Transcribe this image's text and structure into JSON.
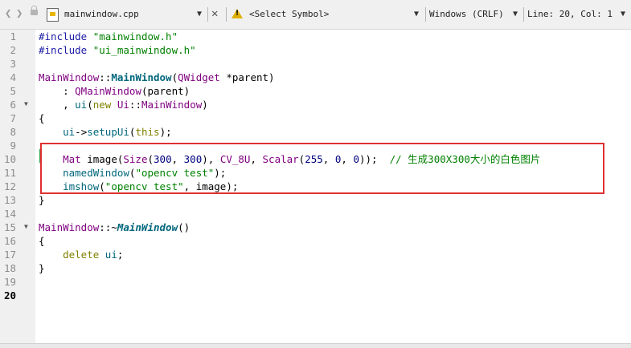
{
  "toolbar": {
    "back": "❮",
    "forward": "❯",
    "filename": "mainwindow.cpp",
    "dropdown": "▼",
    "close": "✕",
    "symbol": "<Select Symbol>",
    "encoding": "Windows (CRLF)",
    "position": "Line: 20, Col: 1",
    "warn_mark": "!"
  },
  "lines": [
    {
      "n": "1",
      "segs": [
        {
          "t": "#include ",
          "c": "c-pre"
        },
        {
          "t": "\"mainwindow.h\"",
          "c": "c-str"
        }
      ]
    },
    {
      "n": "2",
      "segs": [
        {
          "t": "#include ",
          "c": "c-pre"
        },
        {
          "t": "\"ui_mainwindow.h\"",
          "c": "c-str"
        }
      ]
    },
    {
      "n": "3",
      "segs": []
    },
    {
      "n": "4",
      "segs": [
        {
          "t": "MainWindow",
          "c": "c-cls"
        },
        {
          "t": "::",
          "c": ""
        },
        {
          "t": "MainWindow",
          "c": "c-bold"
        },
        {
          "t": "(",
          "c": ""
        },
        {
          "t": "QWidget",
          "c": "c-cls"
        },
        {
          "t": " *parent)",
          "c": ""
        }
      ]
    },
    {
      "n": "5",
      "segs": [
        {
          "t": "    : ",
          "c": ""
        },
        {
          "t": "QMainWindow",
          "c": "c-cls"
        },
        {
          "t": "(parent)",
          "c": ""
        }
      ]
    },
    {
      "n": "6",
      "segs": [
        {
          "t": "    , ",
          "c": ""
        },
        {
          "t": "ui",
          "c": "c-fn"
        },
        {
          "t": "(",
          "c": ""
        },
        {
          "t": "new",
          "c": "c-kw"
        },
        {
          "t": " ",
          "c": ""
        },
        {
          "t": "Ui",
          "c": "c-cls"
        },
        {
          "t": "::",
          "c": ""
        },
        {
          "t": "MainWindow",
          "c": "c-cls"
        },
        {
          "t": ")",
          "c": ""
        }
      ]
    },
    {
      "n": "7",
      "segs": [
        {
          "t": "{",
          "c": ""
        }
      ]
    },
    {
      "n": "8",
      "segs": [
        {
          "t": "    ",
          "c": ""
        },
        {
          "t": "ui",
          "c": "c-fn"
        },
        {
          "t": "->",
          "c": ""
        },
        {
          "t": "setupUi",
          "c": "c-fn"
        },
        {
          "t": "(",
          "c": ""
        },
        {
          "t": "this",
          "c": "c-kw"
        },
        {
          "t": ");",
          "c": ""
        }
      ]
    },
    {
      "n": "9",
      "segs": []
    },
    {
      "n": "10",
      "segs": [
        {
          "t": "    ",
          "c": ""
        },
        {
          "t": "Mat",
          "c": "c-cls"
        },
        {
          "t": " image(",
          "c": ""
        },
        {
          "t": "Size",
          "c": "c-cls"
        },
        {
          "t": "(",
          "c": ""
        },
        {
          "t": "300",
          "c": "c-num"
        },
        {
          "t": ", ",
          "c": ""
        },
        {
          "t": "300",
          "c": "c-num"
        },
        {
          "t": "), ",
          "c": ""
        },
        {
          "t": "CV_8U",
          "c": "c-cls"
        },
        {
          "t": ", ",
          "c": ""
        },
        {
          "t": "Scalar",
          "c": "c-cls"
        },
        {
          "t": "(",
          "c": ""
        },
        {
          "t": "255",
          "c": "c-num"
        },
        {
          "t": ", ",
          "c": ""
        },
        {
          "t": "0",
          "c": "c-num"
        },
        {
          "t": ", ",
          "c": ""
        },
        {
          "t": "0",
          "c": "c-num"
        },
        {
          "t": "));  ",
          "c": ""
        },
        {
          "t": "// 生成300X300大小的白色图片",
          "c": "c-cmt"
        }
      ]
    },
    {
      "n": "11",
      "segs": [
        {
          "t": "    ",
          "c": ""
        },
        {
          "t": "namedWindow",
          "c": "c-fn"
        },
        {
          "t": "(",
          "c": ""
        },
        {
          "t": "\"opencv test\"",
          "c": "c-str"
        },
        {
          "t": ");",
          "c": ""
        }
      ]
    },
    {
      "n": "12",
      "segs": [
        {
          "t": "    ",
          "c": ""
        },
        {
          "t": "imshow",
          "c": "c-fn"
        },
        {
          "t": "(",
          "c": ""
        },
        {
          "t": "\"opencv test\"",
          "c": "c-str"
        },
        {
          "t": ", image);",
          "c": ""
        }
      ]
    },
    {
      "n": "13",
      "segs": [
        {
          "t": "}",
          "c": ""
        }
      ]
    },
    {
      "n": "14",
      "segs": []
    },
    {
      "n": "15",
      "segs": [
        {
          "t": "MainWindow",
          "c": "c-cls"
        },
        {
          "t": "::~",
          "c": ""
        },
        {
          "t": "MainWindow",
          "c": "c-dtor"
        },
        {
          "t": "()",
          "c": ""
        }
      ]
    },
    {
      "n": "16",
      "segs": [
        {
          "t": "{",
          "c": ""
        }
      ]
    },
    {
      "n": "17",
      "segs": [
        {
          "t": "    ",
          "c": ""
        },
        {
          "t": "delete",
          "c": "c-kw"
        },
        {
          "t": " ",
          "c": ""
        },
        {
          "t": "ui",
          "c": "c-fn"
        },
        {
          "t": ";",
          "c": ""
        }
      ]
    },
    {
      "n": "18",
      "segs": [
        {
          "t": "}",
          "c": ""
        }
      ]
    },
    {
      "n": "19",
      "segs": []
    },
    {
      "n": "20",
      "segs": [],
      "current": true
    }
  ],
  "fold_markers": [
    {
      "line": "6"
    },
    {
      "line": "15"
    }
  ],
  "fold_glyph": "▼",
  "colors": {
    "highlight_box": "#e03030",
    "modified_bar": "#2ea043"
  }
}
